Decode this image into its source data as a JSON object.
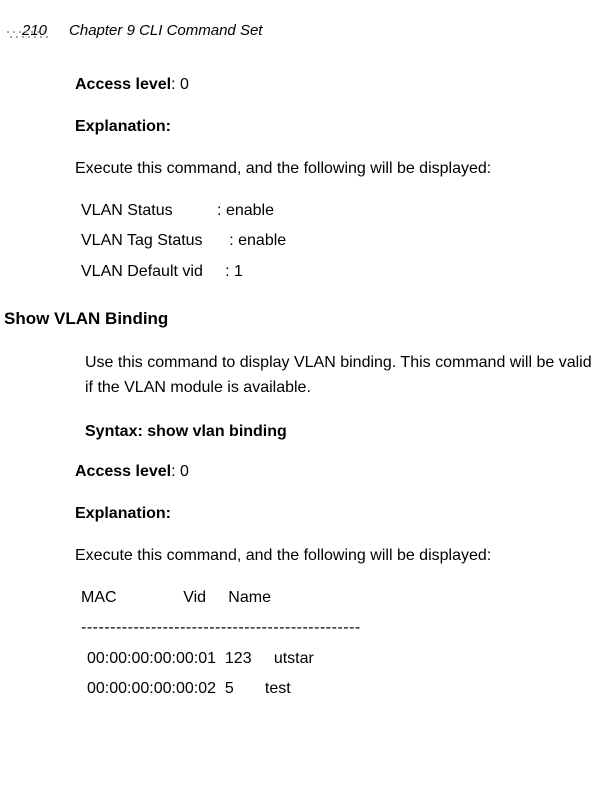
{
  "header": {
    "page_number": "210",
    "chapter_title": "Chapter 9 CLI Command Set"
  },
  "section1": {
    "access_label": "Access level",
    "access_value": ": 0",
    "explanation_heading": "Explanation:",
    "exec_text": "Execute this command, and the following will be displayed:",
    "output": {
      "line1": "VLAN Status          : enable",
      "line2": "VLAN Tag Status      : enable",
      "line3": "VLAN Default vid     : 1"
    }
  },
  "section2": {
    "heading": "Show VLAN Binding",
    "description": "Use this command to display VLAN binding. This command will be valid if the VLAN module is available.",
    "syntax_line": "Syntax: show vlan binding",
    "access_label": "Access level",
    "access_value": ": 0",
    "explanation_heading": "Explanation:",
    "exec_text": "Execute this command, and the following will be displayed:",
    "table": {
      "header": "MAC               Vid     Name",
      "sep": "------------------------------------------------",
      "row1": "00:00:00:00:00:01  123     utstar",
      "row2": "00:00:00:00:00:02  5       test"
    }
  }
}
